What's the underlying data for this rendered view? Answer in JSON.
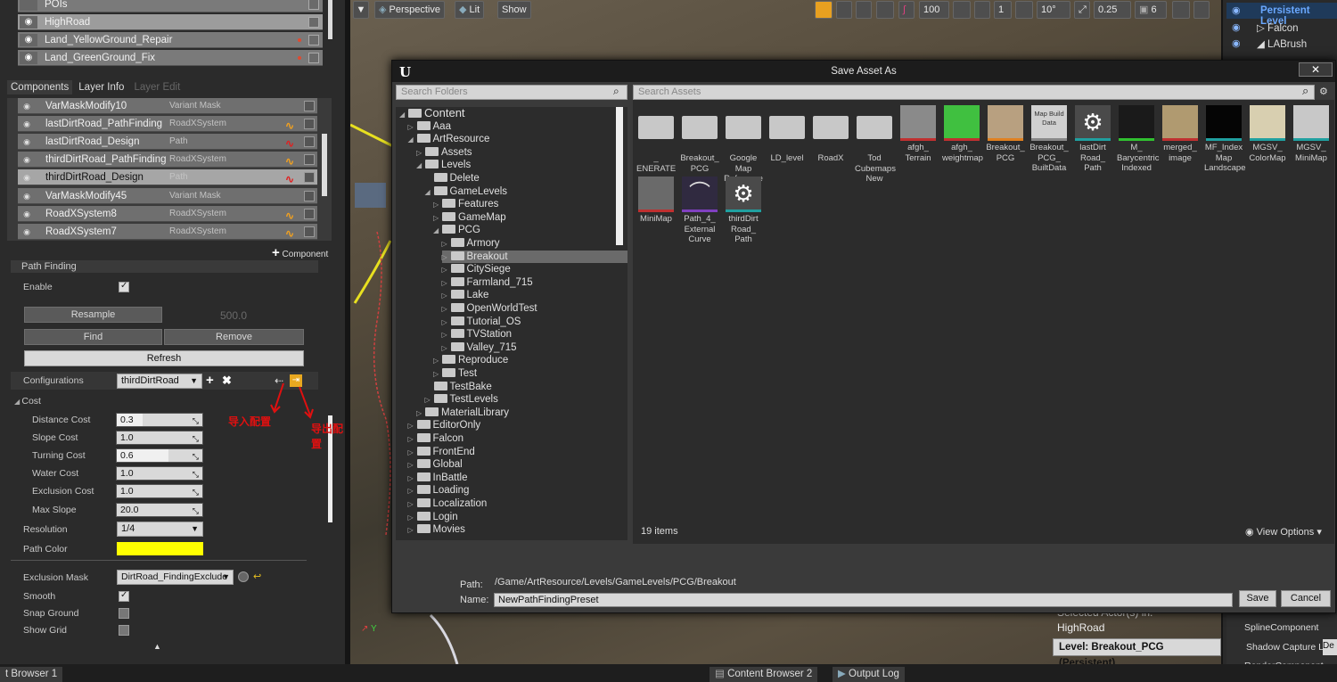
{
  "left_panel": {
    "layers": [
      {
        "name": "POIs"
      },
      {
        "name": "HighRoad"
      },
      {
        "name": "Land_YellowGround_Repair"
      },
      {
        "name": "Land_GreenGround_Fix"
      }
    ],
    "tabs": [
      "Components",
      "Layer Info",
      "Layer Edit"
    ],
    "components": [
      {
        "name": "VarMaskModify10",
        "type": "Variant Mask"
      },
      {
        "name": "lastDirtRoad_PathFinding",
        "type": "RoadXSystem"
      },
      {
        "name": "lastDirtRoad_Design",
        "type": "Path"
      },
      {
        "name": "thirdDirtRoad_PathFinding",
        "type": "RoadXSystem"
      },
      {
        "name": "thirdDirtRoad_Design",
        "type": "Path"
      },
      {
        "name": "VarMaskModify45",
        "type": "Variant Mask"
      },
      {
        "name": "RoadXSystem8",
        "type": "RoadXSystem"
      },
      {
        "name": "RoadXSystem7",
        "type": "RoadXSystem"
      }
    ],
    "add_component": "Component",
    "section_title": "Path Finding",
    "enable_label": "Enable",
    "resample_label": "Resample",
    "resample_value": "500.0",
    "find_label": "Find",
    "remove_label": "Remove",
    "refresh_label": "Refresh",
    "configurations_label": "Configurations",
    "configurations_value": "thirdDirtRoad",
    "cost_label": "Cost",
    "costs": [
      {
        "label": "Distance Cost",
        "value": "0.3",
        "fill": 0.3
      },
      {
        "label": "Slope Cost",
        "value": "1.0",
        "fill": 0
      },
      {
        "label": "Turning Cost",
        "value": "0.6",
        "fill": 0.6
      },
      {
        "label": "Water Cost",
        "value": "1.0",
        "fill": 0
      },
      {
        "label": "Exclusion Cost",
        "value": "1.0",
        "fill": 0
      },
      {
        "label": "Max Slope",
        "value": "20.0",
        "fill": 0
      }
    ],
    "resolution_label": "Resolution",
    "resolution_value": "1/4",
    "path_color_label": "Path Color",
    "path_color": "#ffff00",
    "exclusion_mask_label": "Exclusion Mask",
    "exclusion_mask_value": "DirtRoad_FindingExclude",
    "smooth_label": "Smooth",
    "smooth": true,
    "snap_ground_label": "Snap Ground",
    "snap_ground": false,
    "show_grid_label": "Show Grid",
    "show_grid": false,
    "import_annotation": "导入配置",
    "export_annotation": "导出配置"
  },
  "viewport": {
    "perspective": "Perspective",
    "lit": "Lit",
    "show": "Show",
    "grid_value": "100",
    "rot_value": "10°",
    "scale_value": "0.25",
    "speed_value": "6",
    "one": "1",
    "selected_actor_label": "Selected Actor(s) in:",
    "selected_actor": "HighRoad",
    "level_badge": "Level:  Breakout_PCG (Persistent)"
  },
  "outliner": {
    "items": [
      "Persistent Level",
      "Falcon",
      "LABrush"
    ],
    "details": [
      "SplineComponent",
      "Shadow Capture L",
      "RenderComponent"
    ],
    "details_btn": "De"
  },
  "dialog": {
    "title": "Save Asset As",
    "search_folders": "Search Folders",
    "search_assets": "Search Assets",
    "tree": [
      {
        "label": "Content",
        "depth": 0,
        "exp": true
      },
      {
        "label": "Aaa",
        "depth": 1,
        "exp": false
      },
      {
        "label": "ArtResource",
        "depth": 1,
        "exp": true
      },
      {
        "label": "Assets",
        "depth": 2,
        "exp": false
      },
      {
        "label": "Levels",
        "depth": 2,
        "exp": true
      },
      {
        "label": "Delete",
        "depth": 3,
        "exp": null
      },
      {
        "label": "GameLevels",
        "depth": 3,
        "exp": true
      },
      {
        "label": "Features",
        "depth": 4,
        "exp": false
      },
      {
        "label": "GameMap",
        "depth": 4,
        "exp": false
      },
      {
        "label": "PCG",
        "depth": 4,
        "exp": true
      },
      {
        "label": "Armory",
        "depth": 5,
        "exp": false
      },
      {
        "label": "Breakout",
        "depth": 5,
        "exp": false,
        "sel": true
      },
      {
        "label": "CitySiege",
        "depth": 5,
        "exp": false
      },
      {
        "label": "Farmland_715",
        "depth": 5,
        "exp": false
      },
      {
        "label": "Lake",
        "depth": 5,
        "exp": false
      },
      {
        "label": "OpenWorldTest",
        "depth": 5,
        "exp": false
      },
      {
        "label": "Tutorial_OS",
        "depth": 5,
        "exp": false
      },
      {
        "label": "TVStation",
        "depth": 5,
        "exp": false
      },
      {
        "label": "Valley_715",
        "depth": 5,
        "exp": false
      },
      {
        "label": "Reproduce",
        "depth": 4,
        "exp": false
      },
      {
        "label": "Test",
        "depth": 4,
        "exp": false
      },
      {
        "label": "TestBake",
        "depth": 3,
        "exp": null
      },
      {
        "label": "TestLevels",
        "depth": 3,
        "exp": false
      },
      {
        "label": "MaterialLibrary",
        "depth": 2,
        "exp": false
      },
      {
        "label": "EditorOnly",
        "depth": 1,
        "exp": false
      },
      {
        "label": "Falcon",
        "depth": 1,
        "exp": false
      },
      {
        "label": "FrontEnd",
        "depth": 1,
        "exp": false
      },
      {
        "label": "Global",
        "depth": 1,
        "exp": false
      },
      {
        "label": "InBattle",
        "depth": 1,
        "exp": false
      },
      {
        "label": "Loading",
        "depth": 1,
        "exp": false
      },
      {
        "label": "Localization",
        "depth": 1,
        "exp": false
      },
      {
        "label": "Login",
        "depth": 1,
        "exp": false
      },
      {
        "label": "Movies",
        "depth": 1,
        "exp": false
      }
    ],
    "assets": [
      {
        "label": "_ ENERATE",
        "kind": "folder"
      },
      {
        "label": "Breakout_ PCG",
        "kind": "folder"
      },
      {
        "label": "Google Map Reference",
        "kind": "folder"
      },
      {
        "label": "LD_level",
        "kind": "folder"
      },
      {
        "label": "RoadX",
        "kind": "folder"
      },
      {
        "label": "Tod Cubemaps New",
        "kind": "folder"
      },
      {
        "label": "afgh_ Terrain",
        "kind": "tex",
        "color": "#8a8a8a",
        "bar": "#c03030"
      },
      {
        "label": "afgh_ weightmap",
        "kind": "tex",
        "color": "#40c040",
        "bar": "#c03030"
      },
      {
        "label": "Breakout_ PCG",
        "kind": "tex",
        "color": "#b8a080",
        "bar": "#e08020"
      },
      {
        "label": "Breakout_ PCG_ BuiltData",
        "kind": "text",
        "color": "#d0d0d0",
        "bar": "#888",
        "inner": "Map Build Data"
      },
      {
        "label": "lastDirt Road_ Path",
        "kind": "gear",
        "color": "#4a4a4a",
        "bar": "#20a0a0"
      },
      {
        "label": "M_ Barycentric Indexed",
        "kind": "tex",
        "color": "#1a1a1a",
        "bar": "#30c030"
      },
      {
        "label": "merged_ image",
        "kind": "tex",
        "color": "#b09a70",
        "bar": "#c03030"
      },
      {
        "label": "MF_Index Map Landscape",
        "kind": "tex",
        "color": "#050505",
        "bar": "#20a0a0"
      },
      {
        "label": "MGSV_ ColorMap",
        "kind": "tex",
        "color": "#d8cfb0",
        "bar": "#20a0a0"
      },
      {
        "label": "MGSV_ MiniMap",
        "kind": "tex",
        "color": "#c8c8c8",
        "bar": "#20a0a0"
      },
      {
        "label": "MiniMap",
        "kind": "tex",
        "color": "#6a6a6a",
        "bar": "#c03030"
      },
      {
        "label": "Path_4_ External Curve",
        "kind": "curve",
        "color": "#302a40",
        "bar": "#8040c0"
      },
      {
        "label": "thirdDirt Road_ Path",
        "kind": "gear",
        "color": "#4a4a4a",
        "bar": "#20a0a0"
      }
    ],
    "item_count": "19 items",
    "view_options": "View Options",
    "path_label": "Path:",
    "path_value": "/Game/ArtResource/Levels/GameLevels/PCG/Breakout",
    "name_label": "Name:",
    "name_value": "NewPathFindingPreset",
    "save_label": "Save",
    "cancel_label": "Cancel",
    "close_icon": "close-icon"
  },
  "bottom_tabs": [
    "t Browser 1",
    "Content Browser 2",
    "Output Log"
  ]
}
